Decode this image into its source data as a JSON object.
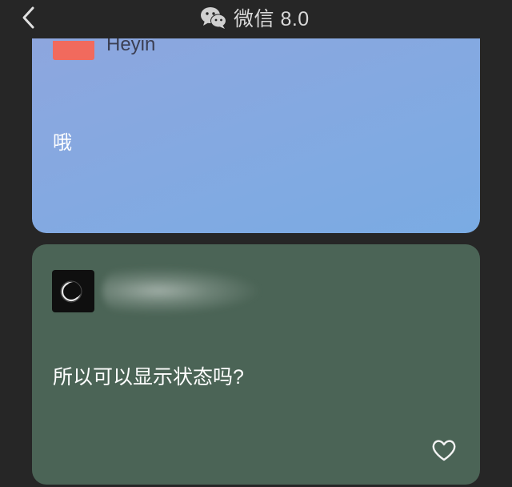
{
  "header": {
    "title": "微信 8.0",
    "back_icon": "chevron-left-icon",
    "logo_icon": "wechat-logo-icon"
  },
  "cards": [
    {
      "background": "#84a9e1",
      "avatar_color": "#f16a5d",
      "name_partial": "Heyin",
      "text": "哦"
    },
    {
      "background": "#4b6456",
      "text": "所以可以显示状态吗?",
      "like_icon": "heart-outline-icon"
    }
  ]
}
